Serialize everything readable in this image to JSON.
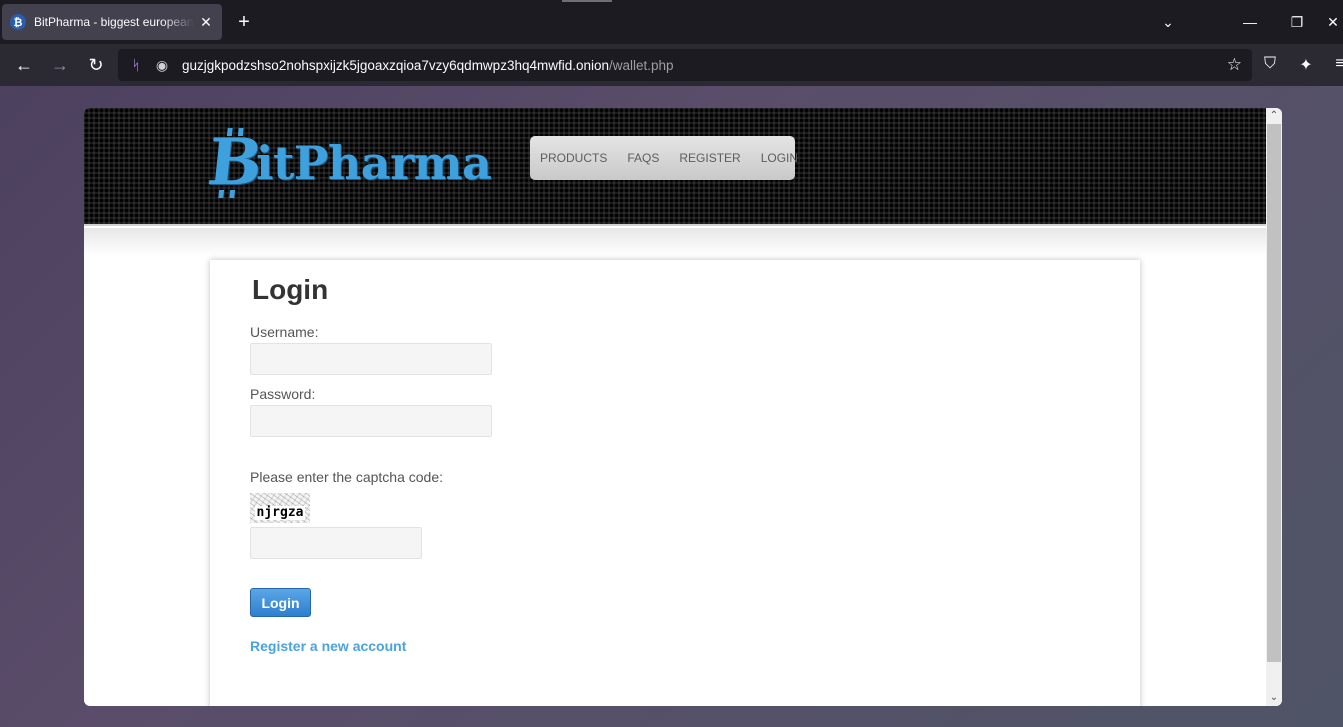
{
  "browser": {
    "tab_title": "BitPharma - biggest european",
    "tab_close": "✕",
    "new_tab": "+",
    "url_host": "guzjgkpodzshso2nohspxijzk5jgoaxzqioa7vzy6qdmwpz3hq4mwfid.onion",
    "url_path": "/wallet.php",
    "icons": [
      "back-icon",
      "forward-icon",
      "reload-icon",
      "tor-circuit-icon",
      "onion-icon",
      "bookmark-star-icon",
      "shield-icon",
      "magic-wand-icon",
      "menu-icon",
      "tab-list-icon",
      "minimize-icon",
      "restore-icon",
      "close-icon"
    ]
  },
  "site": {
    "logo_text": "itPharma",
    "logo_letter": "B",
    "menu": [
      {
        "label": "PRODUCTS"
      },
      {
        "label": "FAQS"
      },
      {
        "label": "REGISTER"
      },
      {
        "label": "LOGIN"
      }
    ],
    "accent_color": "#3ea0dc"
  },
  "login": {
    "title": "Login",
    "username_label": "Username:",
    "username_value": "",
    "password_label": "Password:",
    "password_value": "",
    "captcha_label": "Please enter the captcha code:",
    "captcha_code": "njrgza",
    "captcha_value": "",
    "submit_label": "Login",
    "register_link": "Register a new account"
  }
}
